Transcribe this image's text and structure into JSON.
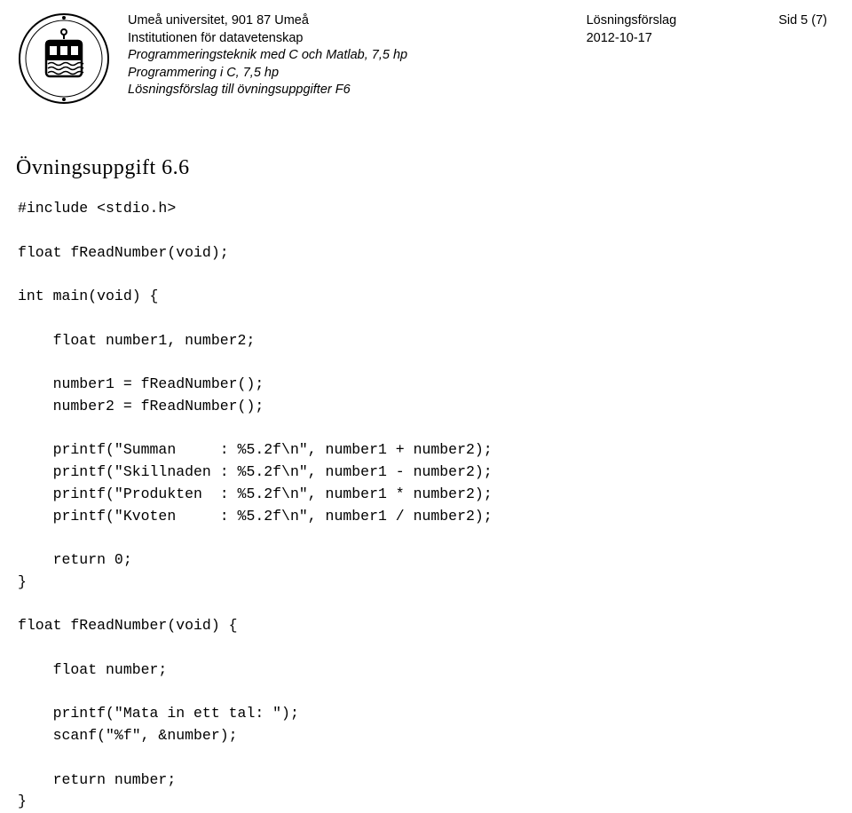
{
  "header": {
    "uni_line1": "Umeå universitet, 901 87 Umeå",
    "uni_line2": "Institutionen för datavetenskap",
    "uni_line3": "Programmeringsteknik med C och Matlab, 7,5 hp",
    "uni_line4": "Programmering i C, 7,5 hp",
    "uni_line5": "Lösningsförslag till övningsuppgifter F6",
    "right_label": "Lösningsförslag",
    "right_page": "Sid 5 (7)",
    "right_date": "2012-10-17"
  },
  "exercise": {
    "heading": "Övningsuppgift 6.6"
  },
  "code": {
    "line01": "#include <stdio.h>",
    "line02": "",
    "line03": "float fReadNumber(void);",
    "line04": "",
    "line05": "int main(void) {",
    "line06": "",
    "line07": "    float number1, number2;",
    "line08": "",
    "line09": "    number1 = fReadNumber();",
    "line10": "    number2 = fReadNumber();",
    "line11": "",
    "line12": "    printf(\"Summan     : %5.2f\\n\", number1 + number2);",
    "line13": "    printf(\"Skillnaden : %5.2f\\n\", number1 - number2);",
    "line14": "    printf(\"Produkten  : %5.2f\\n\", number1 * number2);",
    "line15": "    printf(\"Kvoten     : %5.2f\\n\", number1 / number2);",
    "line16": "",
    "line17": "    return 0;",
    "line18": "}",
    "line19": "",
    "line20": "float fReadNumber(void) {",
    "line21": "",
    "line22": "    float number;",
    "line23": "",
    "line24": "    printf(\"Mata in ett tal: \");",
    "line25": "    scanf(\"%f\", &number);",
    "line26": "",
    "line27": "    return number;",
    "line28": "}"
  }
}
